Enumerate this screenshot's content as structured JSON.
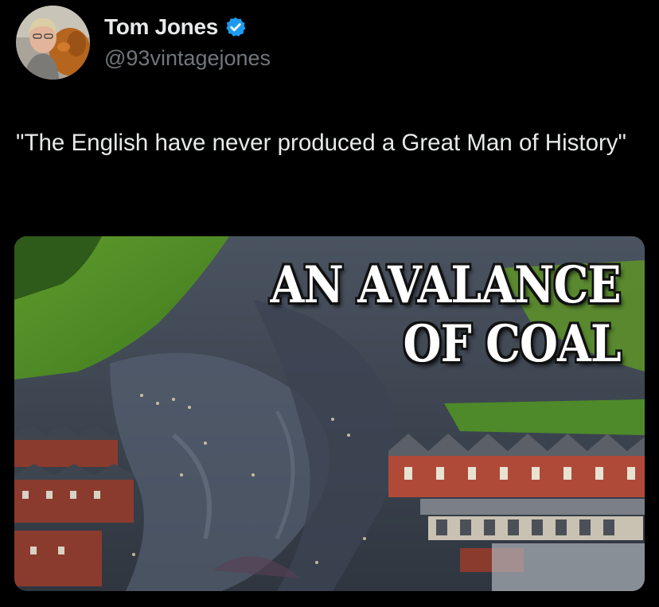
{
  "user": {
    "display_name": "Tom Jones",
    "handle": "@93vintagejones",
    "verified": true
  },
  "tweet": {
    "text": "\"The English have never produced a Great Man of History\""
  },
  "media": {
    "headline_line1": "AN AVALANCE",
    "headline_line2": "OF COAL"
  },
  "colors": {
    "background": "#000000",
    "text_primary": "#e7e9ea",
    "text_secondary": "#71767b",
    "verified_badge": "#1d9bf0"
  },
  "icons": {
    "verified": "verified-badge-icon"
  }
}
